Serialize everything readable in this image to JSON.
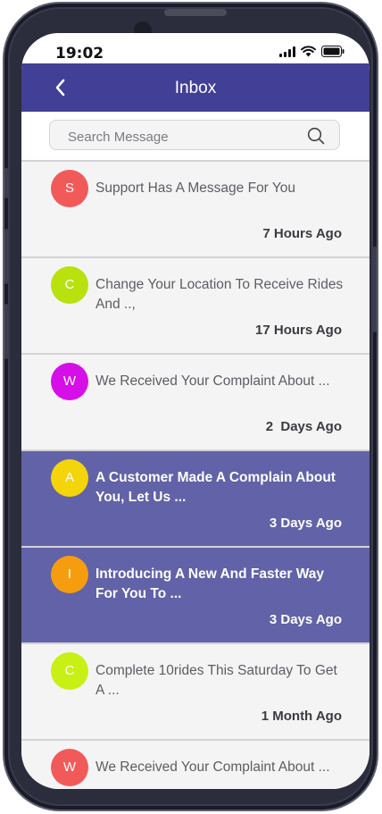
{
  "status_bar": {
    "time": "19:02"
  },
  "header": {
    "title": "Inbox",
    "back_icon": "chevron-left-icon"
  },
  "search": {
    "placeholder": "Search Message",
    "value": "",
    "icon": "search-icon"
  },
  "colors": {
    "header": "#423f96",
    "highlight": "#6262a8",
    "background": "#f4f4f5"
  },
  "messages": [
    {
      "initial": "S",
      "text": "Support Has A Message For You",
      "time": "7 Hours Ago",
      "avatar_color": "#f25a5a",
      "highlighted": false
    },
    {
      "initial": "C",
      "text": "Change Your Location To Receive Rides And ..,",
      "time": "17 Hours Ago",
      "avatar_color": "#b8e10e",
      "highlighted": false
    },
    {
      "initial": "W",
      "text": "We Received Your Complaint About  ...",
      "time": "2  Days Ago",
      "avatar_color": "#d60fe8",
      "highlighted": false
    },
    {
      "initial": "A",
      "text": "A Customer Made A Complain About You, Let Us ...",
      "time": "3 Days Ago",
      "avatar_color": "#f4d40a",
      "highlighted": true
    },
    {
      "initial": "I",
      "text": "Introducing A New And Faster Way For You To ...",
      "time": "3 Days Ago",
      "avatar_color": "#f59d0e",
      "highlighted": true
    },
    {
      "initial": "C",
      "text": "Complete 10rides This Saturday To Get A ...",
      "time": "1 Month Ago",
      "avatar_color": "#c8f014",
      "highlighted": false
    },
    {
      "initial": "W",
      "text": "We Received Your Complaint About ...",
      "time": "",
      "avatar_color": "#f25a5a",
      "highlighted": false
    }
  ]
}
